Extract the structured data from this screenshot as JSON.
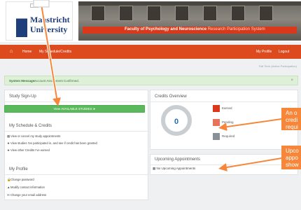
{
  "header": {
    "logo_line1": "Maastricht",
    "logo_line2": "University",
    "banner_title": "Faculty of Psychology and Neuroscience",
    "banner_subtitle": "Research Participation System"
  },
  "nav": {
    "items": [
      "Home",
      "My Schedule/Credits"
    ],
    "right_items": [
      "My Profile",
      "Logout"
    ]
  },
  "session_text": "Fall Term (Active Participation)",
  "system_message": {
    "label": "System Message:",
    "text": "Account Assignment Confirmed."
  },
  "study_signup": {
    "title": "Study Sign-Up",
    "button_label": "View AVAILABLE STUDIES"
  },
  "schedule": {
    "title": "My Schedule & Credits",
    "items": [
      "View or cancel my study appointments",
      "View studies I've participated in, and see if credit has been granted",
      "View other Credits I've earned"
    ]
  },
  "profile": {
    "title": "My Profile",
    "items": [
      "Change password",
      "Modify contact information",
      "Change your email address"
    ]
  },
  "credits": {
    "title": "Credits Overview",
    "total": "0",
    "legend": [
      {
        "label": "Earned",
        "color": "#d9391a"
      },
      {
        "label": "Pending",
        "color": "#e8735a"
      },
      {
        "label": "Required",
        "color": "#8a9097"
      }
    ]
  },
  "appointments": {
    "title": "Upcoming Appointments",
    "empty_text": "No Upcoming Appointments"
  },
  "callouts": {
    "credits": [
      "An o",
      "credi",
      "requi"
    ],
    "appointments": [
      "Upco",
      "appo",
      "show"
    ]
  },
  "colors": {
    "accent": "#dc4a1e",
    "green_button": "#5cb85c",
    "callout": "#f6873a"
  }
}
